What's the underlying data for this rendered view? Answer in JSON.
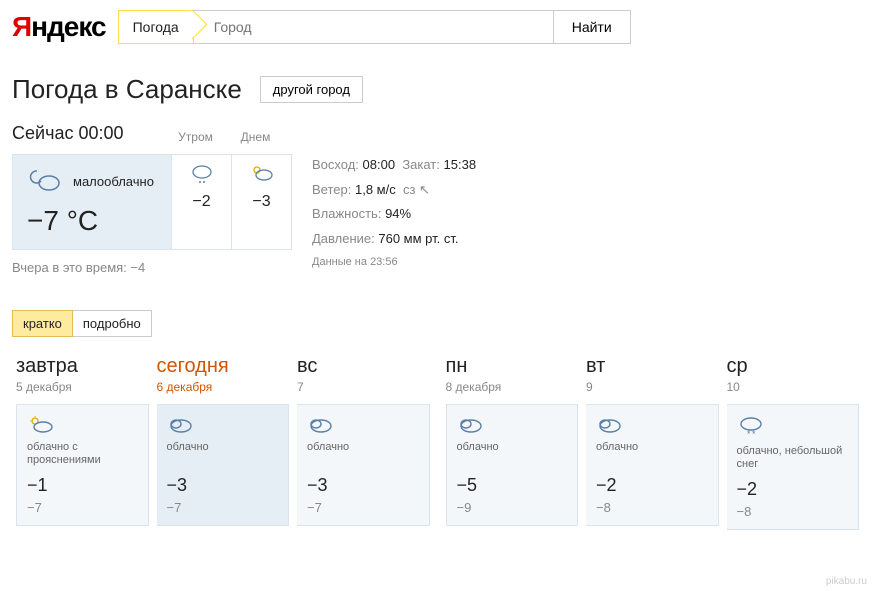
{
  "header": {
    "logo_plain": "ндекс",
    "logo_accent": "Я",
    "search_tag": "Погода",
    "search_placeholder": "Город",
    "search_button": "Найти"
  },
  "title": "Погода в Саранске",
  "other_city_btn": "другой город",
  "now": {
    "label": "Сейчас",
    "time": "00:00",
    "condition": "малооблачно",
    "temp": "−7 °C",
    "parts": [
      {
        "label": "Утром",
        "temp": "−2",
        "icon": "snow-cloud"
      },
      {
        "label": "Днем",
        "temp": "−3",
        "icon": "sun-cloud"
      }
    ]
  },
  "details": {
    "sunrise_lbl": "Восход:",
    "sunrise": "08:00",
    "sunset_lbl": "Закат:",
    "sunset": "15:38",
    "wind_lbl": "Ветер:",
    "wind": "1,8 м/с",
    "wind_dir": "сз",
    "humidity_lbl": "Влажность:",
    "humidity": "94%",
    "pressure_lbl": "Давление:",
    "pressure": "760 мм рт. ст.",
    "data_lbl": "Данные на",
    "data_time": "23:56"
  },
  "yesterday": {
    "label": "Вчера в это время:",
    "temp": "−4"
  },
  "tabs": {
    "brief": "кратко",
    "detailed": "подробно"
  },
  "forecast": [
    {
      "name": "завтра",
      "date": "5 декабря",
      "cond": "облачно с прояснениями",
      "hi": "−1",
      "lo": "−7",
      "icon": "sun-cloud",
      "today": false,
      "group": 0
    },
    {
      "name": "сегодня",
      "date": "6 декабря",
      "cond": "облачно",
      "hi": "−3",
      "lo": "−7",
      "icon": "cloud",
      "today": true,
      "group": 0
    },
    {
      "name": "вс",
      "date": "7",
      "cond": "облачно",
      "hi": "−3",
      "lo": "−7",
      "icon": "cloud",
      "today": false,
      "group": 0
    },
    {
      "name": "пн",
      "date": "8 декабря",
      "cond": "облачно",
      "hi": "−5",
      "lo": "−9",
      "icon": "cloud",
      "today": false,
      "group": 1
    },
    {
      "name": "вт",
      "date": "9",
      "cond": "облачно",
      "hi": "−2",
      "lo": "−8",
      "icon": "cloud",
      "today": false,
      "group": 1
    },
    {
      "name": "ср",
      "date": "10",
      "cond": "облачно, небольшой снег",
      "hi": "−2",
      "lo": "−8",
      "icon": "snow-cloud",
      "today": false,
      "group": 1
    }
  ],
  "watermark": "pikabu.ru"
}
